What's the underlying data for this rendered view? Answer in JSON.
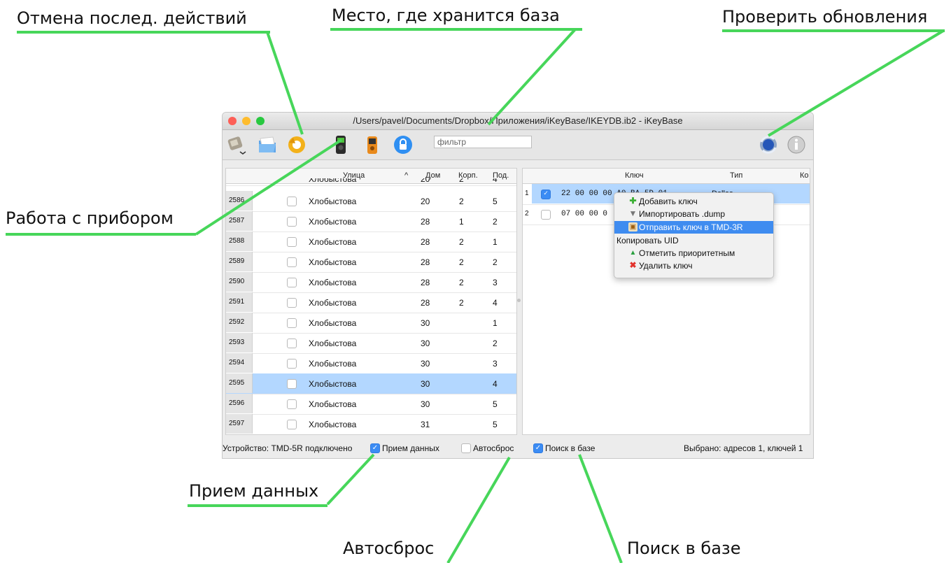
{
  "annotations": {
    "undo": "Отмена послед. действий",
    "db_location": "Место, где хранится база",
    "check_updates": "Проверить обновления",
    "device_work": "Работа с прибором",
    "receive_data": "Прием данных",
    "auto_reset": "Автосброс",
    "search_db": "Поиск в базе"
  },
  "window": {
    "title": "/Users/pavel/Documents/Dropbox/Приложения/iKeyBase/IKEYDB.ib2 - iKeyBase"
  },
  "toolbar": {
    "filter_placeholder": "фильтр",
    "icons": [
      "keys-menu-icon",
      "folder-icon",
      "undo-icon",
      "key-reader-green-icon",
      "key-reader-orange-icon",
      "lock-icon",
      "sync-update-icon",
      "info-icon"
    ]
  },
  "addresses": {
    "columns": {
      "street": "Улица",
      "house": "Дом",
      "building": "Корп.",
      "entrance": "Под."
    },
    "sort_indicator": "^",
    "partial_row": {
      "street": "Хлобыстова",
      "house": "20",
      "building": "2",
      "entrance": "4"
    },
    "rows": [
      {
        "id": "2586",
        "street": "Хлобыстова",
        "house": "20",
        "building": "2",
        "entrance": "5",
        "selected": false
      },
      {
        "id": "2587",
        "street": "Хлобыстова",
        "house": "28",
        "building": "1",
        "entrance": "2",
        "selected": false
      },
      {
        "id": "2588",
        "street": "Хлобыстова",
        "house": "28",
        "building": "2",
        "entrance": "1",
        "selected": false
      },
      {
        "id": "2589",
        "street": "Хлобыстова",
        "house": "28",
        "building": "2",
        "entrance": "2",
        "selected": false
      },
      {
        "id": "2590",
        "street": "Хлобыстова",
        "house": "28",
        "building": "2",
        "entrance": "3",
        "selected": false
      },
      {
        "id": "2591",
        "street": "Хлобыстова",
        "house": "28",
        "building": "2",
        "entrance": "4",
        "selected": false
      },
      {
        "id": "2592",
        "street": "Хлобыстова",
        "house": "30",
        "building": "",
        "entrance": "1",
        "selected": false
      },
      {
        "id": "2593",
        "street": "Хлобыстова",
        "house": "30",
        "building": "",
        "entrance": "2",
        "selected": false
      },
      {
        "id": "2594",
        "street": "Хлобыстова",
        "house": "30",
        "building": "",
        "entrance": "3",
        "selected": false
      },
      {
        "id": "2595",
        "street": "Хлобыстова",
        "house": "30",
        "building": "",
        "entrance": "4",
        "selected": true
      },
      {
        "id": "2596",
        "street": "Хлобыстова",
        "house": "30",
        "building": "",
        "entrance": "5",
        "selected": false
      },
      {
        "id": "2597",
        "street": "Хлобыстова",
        "house": "31",
        "building": "",
        "entrance": "5",
        "selected": false
      }
    ]
  },
  "keys": {
    "columns": {
      "key": "Ключ",
      "type": "Тип",
      "extra": "Ко"
    },
    "rows": [
      {
        "n": "1",
        "key": "22 00 00 00 A0 BA 5D 01",
        "type": "Dallas",
        "checked": true,
        "selected": true
      },
      {
        "n": "2",
        "key": "07 00 00 0",
        "type": "",
        "checked": false,
        "selected": false
      }
    ]
  },
  "context_menu": [
    {
      "icon": "plus-icon",
      "label": "Добавить ключ",
      "highlighted": false
    },
    {
      "icon": "import-icon",
      "label": "Импортировать .dump",
      "highlighted": false
    },
    {
      "icon": "send-icon",
      "label": "Отправить ключ в TMD-3R",
      "highlighted": true
    },
    {
      "icon": "",
      "label": "Копировать UID",
      "highlighted": false
    },
    {
      "icon": "priority-icon",
      "label": "Отметить приоритетным",
      "highlighted": false
    },
    {
      "icon": "delete-icon",
      "label": "Удалить ключ",
      "highlighted": false
    }
  ],
  "status": {
    "device": "Устройство: TMD-5R подключено",
    "receive_data": "Прием данных",
    "receive_data_checked": true,
    "auto_reset": "Автосброс",
    "auto_reset_checked": false,
    "search_db": "Поиск в базе",
    "search_db_checked": true,
    "selected_info": "Выбрано: адресов 1, ключей 1"
  },
  "colors": {
    "accent": "#3f8cf0",
    "selection": "#b3d7ff",
    "callout_line": "#47d65a"
  }
}
